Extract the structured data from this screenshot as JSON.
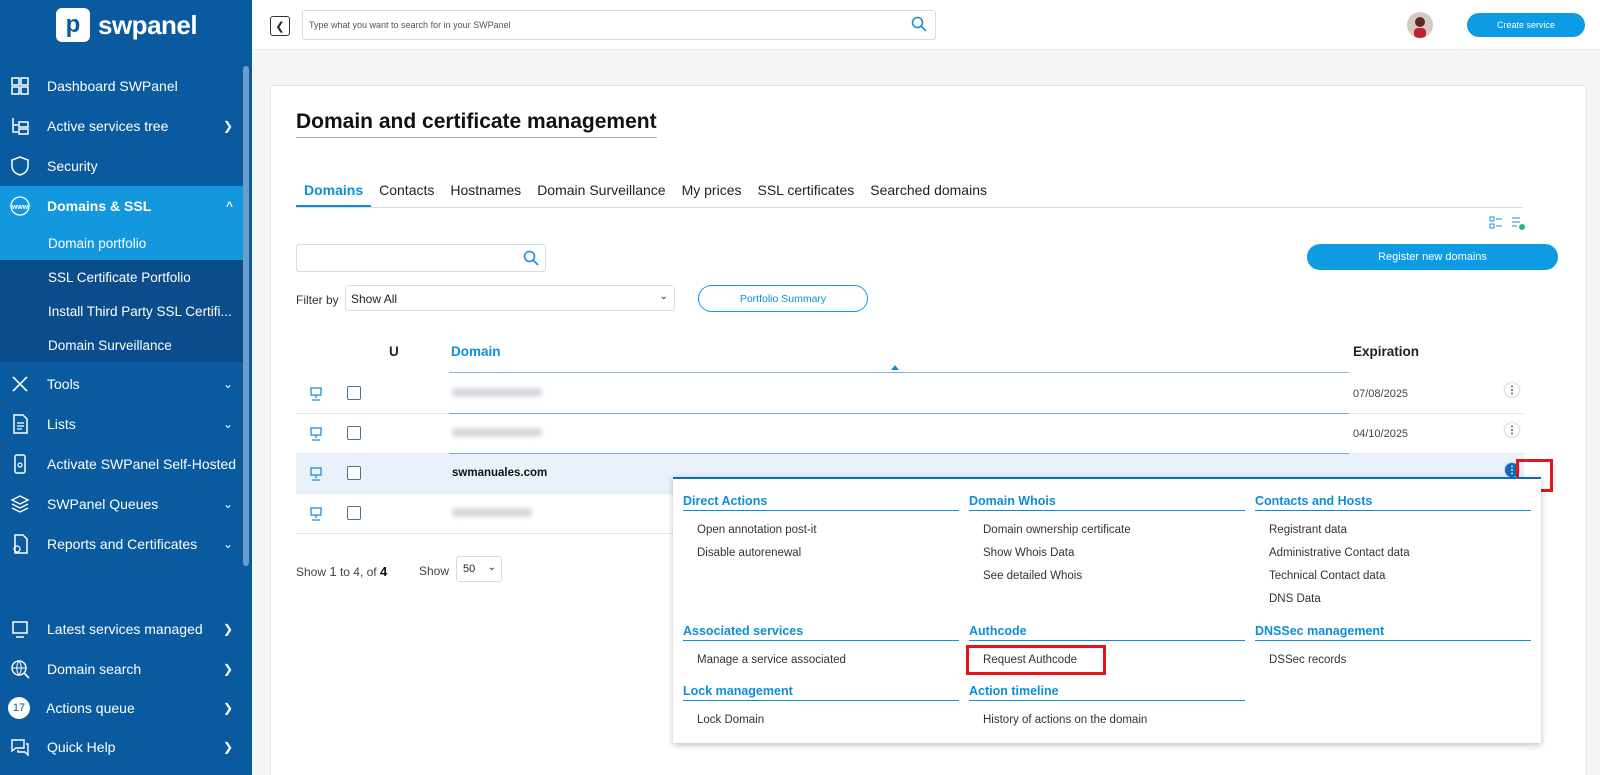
{
  "brand": {
    "name": "swpanel"
  },
  "sidebar": {
    "items": [
      {
        "label": "Dashboard SWPanel",
        "icon": "dashboard-icon"
      },
      {
        "label": "Active services tree",
        "icon": "tree-icon"
      },
      {
        "label": "Security",
        "icon": "shield-icon"
      },
      {
        "label": "Domains & SSL",
        "icon": "www-icon"
      },
      {
        "label": "Tools",
        "icon": "tools-icon"
      },
      {
        "label": "Lists",
        "icon": "list-icon"
      },
      {
        "label": "Activate SWPanel Self-Hosted",
        "icon": "server-icon"
      },
      {
        "label": "SWPanel Queues",
        "icon": "layers-icon"
      },
      {
        "label": "Reports and Certificates",
        "icon": "report-icon"
      },
      {
        "label": "Latest services managed",
        "icon": "monitor-icon"
      },
      {
        "label": "Domain search",
        "icon": "globe-search-icon"
      },
      {
        "label": "Actions queue",
        "icon": "queue-badge",
        "badge": "17"
      },
      {
        "label": "Quick Help",
        "icon": "help-chat-icon"
      }
    ],
    "subitems": [
      {
        "label": "Domain portfolio"
      },
      {
        "label": "SSL Certificate Portfolio"
      },
      {
        "label": "Install Third Party SSL Certifi..."
      },
      {
        "label": "Domain Surveillance"
      }
    ]
  },
  "topbar": {
    "search_placeholder": "Type what you want to search for in your SWPanel",
    "create_label": "Create service"
  },
  "main": {
    "title": "Domain and certificate management",
    "tabs": [
      {
        "label": "Domains"
      },
      {
        "label": "Contacts"
      },
      {
        "label": "Hostnames"
      },
      {
        "label": "Domain Surveillance"
      },
      {
        "label": "My prices"
      },
      {
        "label": "SSL certificates"
      },
      {
        "label": "Searched domains"
      }
    ],
    "register_label": "Register new domains",
    "filter_label": "Filter by",
    "filter_value": "Show All",
    "portfolio_label": "Portfolio Summary",
    "table": {
      "col_u": "U",
      "col_domain": "Domain",
      "col_expiration": "Expiration",
      "rows": [
        {
          "domain": "",
          "expiration": "07/08/2025"
        },
        {
          "domain": "",
          "expiration": "04/10/2025"
        },
        {
          "domain": "swmanuales.com",
          "expiration": ""
        },
        {
          "domain": "",
          "expiration": ""
        }
      ]
    },
    "pager": {
      "prefix": "Show",
      "from": "1",
      "to_text": "to 4, of",
      "total": "4",
      "show_label": "Show",
      "page_size": "50"
    }
  },
  "menu": {
    "sections": [
      {
        "title": "Direct Actions",
        "items": [
          "Open annotation post-it",
          "Disable autorenewal"
        ]
      },
      {
        "title": "Domain Whois",
        "items": [
          "Domain ownership certificate",
          "Show Whois Data",
          "See detailed Whois"
        ]
      },
      {
        "title": "Contacts and Hosts",
        "items": [
          "Registrant data",
          "Administrative Contact data",
          "Technical Contact data",
          "DNS Data"
        ]
      },
      {
        "title": "Associated services",
        "items": [
          "Manage a service associated"
        ]
      },
      {
        "title": "Authcode",
        "items": [
          "Request Authcode"
        ]
      },
      {
        "title": "DNSSec management",
        "items": [
          "DSSec records"
        ]
      },
      {
        "title": "Lock management",
        "items": [
          "Lock Domain"
        ]
      },
      {
        "title": "Action timeline",
        "items": [
          "History of actions on the domain"
        ]
      }
    ]
  },
  "colors": {
    "sidebar": "#0a5aa0",
    "accent": "#0d9ce4",
    "highlight": "#e4141b"
  }
}
